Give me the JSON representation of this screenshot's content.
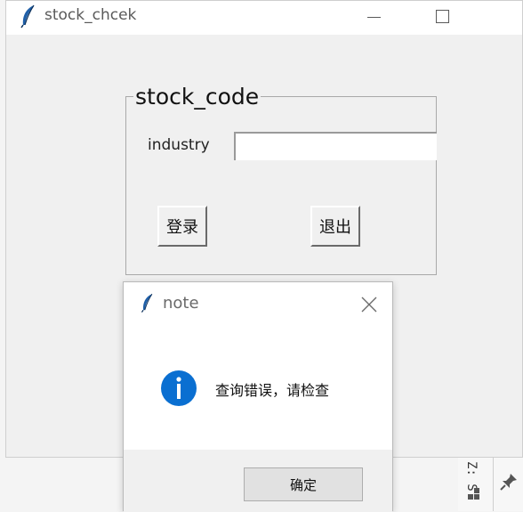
{
  "main_window": {
    "title": "stock_chcek",
    "labelframe_title": "stock_code",
    "industry_label": "industry",
    "industry_value": "",
    "login_button": "登录",
    "exit_button": "退出"
  },
  "dialog": {
    "title": "note",
    "message": "查询错误，请检查",
    "ok_button": "确定",
    "icon": "info-icon"
  },
  "background": {
    "vertical_text": "Z: S"
  },
  "colors": {
    "info_blue": "#0a6fd1",
    "window_bg": "#f0f0f0",
    "titlebar_bg": "#ffffff"
  }
}
